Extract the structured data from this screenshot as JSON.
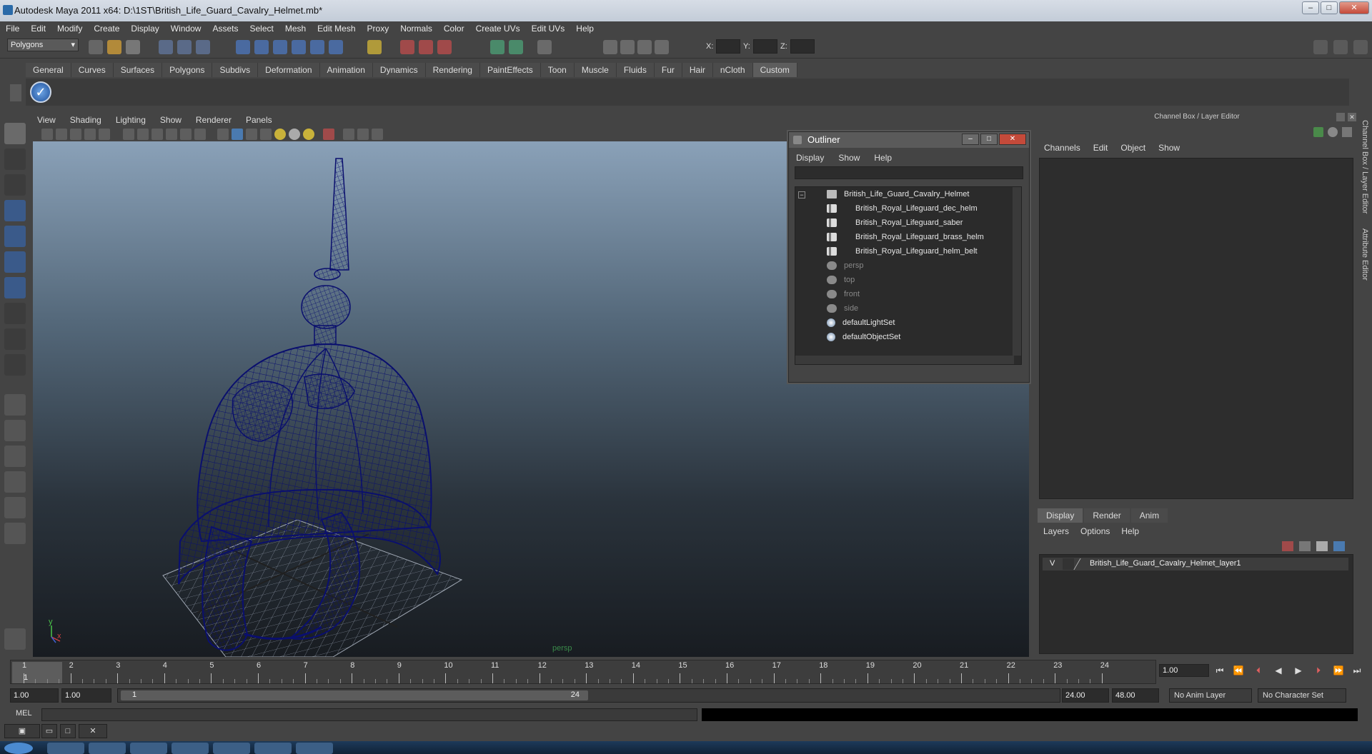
{
  "window": {
    "title": "Autodesk Maya 2011 x64: D:\\1ST\\British_Life_Guard_Cavalry_Helmet.mb*"
  },
  "menubar": [
    "File",
    "Edit",
    "Modify",
    "Create",
    "Display",
    "Window",
    "Assets",
    "Select",
    "Mesh",
    "Edit Mesh",
    "Proxy",
    "Normals",
    "Color",
    "Create UVs",
    "Edit UVs",
    "Help"
  ],
  "statusline": {
    "mode": "Polygons",
    "x_label": "X:",
    "y_label": "Y:",
    "z_label": "Z:"
  },
  "shelf": {
    "tabs": [
      "General",
      "Curves",
      "Surfaces",
      "Polygons",
      "Subdivs",
      "Deformation",
      "Animation",
      "Dynamics",
      "Rendering",
      "PaintEffects",
      "Toon",
      "Muscle",
      "Fluids",
      "Fur",
      "Hair",
      "nCloth",
      "Custom"
    ],
    "active_tab": "Custom"
  },
  "viewport": {
    "menu": [
      "View",
      "Shading",
      "Lighting",
      "Show",
      "Renderer",
      "Panels"
    ],
    "camera": "persp",
    "axis_y": "y",
    "axis_x": "x"
  },
  "outliner": {
    "title": "Outliner",
    "menu": [
      "Display",
      "Show",
      "Help"
    ],
    "items": [
      {
        "label": "British_Life_Guard_Cavalry_Helmet",
        "icon": "group-icon",
        "dim": false
      },
      {
        "label": "British_Royal_Lifeguard_dec_helm",
        "icon": "mesh-icon",
        "dim": false
      },
      {
        "label": "British_Royal_Lifeguard_saber",
        "icon": "mesh-icon",
        "dim": false
      },
      {
        "label": "British_Royal_Lifeguard_brass_helm",
        "icon": "mesh-icon",
        "dim": false
      },
      {
        "label": "British_Royal_Lifeguard_helm_belt",
        "icon": "mesh-icon",
        "dim": false
      },
      {
        "label": "persp",
        "icon": "camera-icon",
        "dim": true
      },
      {
        "label": "top",
        "icon": "camera-icon",
        "dim": true
      },
      {
        "label": "front",
        "icon": "camera-icon",
        "dim": true
      },
      {
        "label": "side",
        "icon": "camera-icon",
        "dim": true
      },
      {
        "label": "defaultLightSet",
        "icon": "set-icon",
        "dim": false
      },
      {
        "label": "defaultObjectSet",
        "icon": "set-icon",
        "dim": false
      }
    ]
  },
  "channelbox": {
    "header": "Channel Box / Layer Editor",
    "menu": [
      "Channels",
      "Edit",
      "Object",
      "Show"
    ],
    "side_tabs": [
      "Channel Box / Layer Editor",
      "Attribute Editor"
    ]
  },
  "layers": {
    "tabs": [
      "Display",
      "Render",
      "Anim"
    ],
    "active_tab": "Display",
    "menu": [
      "Layers",
      "Options",
      "Help"
    ],
    "rows": [
      {
        "visibility": "V",
        "name": "British_Life_Guard_Cavalry_Helmet_layer1"
      }
    ]
  },
  "timeline": {
    "ticks": [
      "1",
      "2",
      "3",
      "4",
      "5",
      "6",
      "7",
      "8",
      "9",
      "10",
      "11",
      "12",
      "13",
      "14",
      "15",
      "16",
      "17",
      "18",
      "19",
      "20",
      "21",
      "22",
      "23",
      "24"
    ],
    "current_frame": "1",
    "current_time": "1.00"
  },
  "range": {
    "start_time": "1.00",
    "start_range": "1.00",
    "range_start_label": "1",
    "range_end_label": "24",
    "end_range": "24.00",
    "end_time": "48.00",
    "anim_layer": "No Anim Layer",
    "character_set": "No Character Set"
  },
  "commandline": {
    "tag": "MEL"
  },
  "colors": {
    "wireframe": "#0a0f6e",
    "ui_bg": "#444444",
    "active_tab": "#5d5d5d"
  }
}
